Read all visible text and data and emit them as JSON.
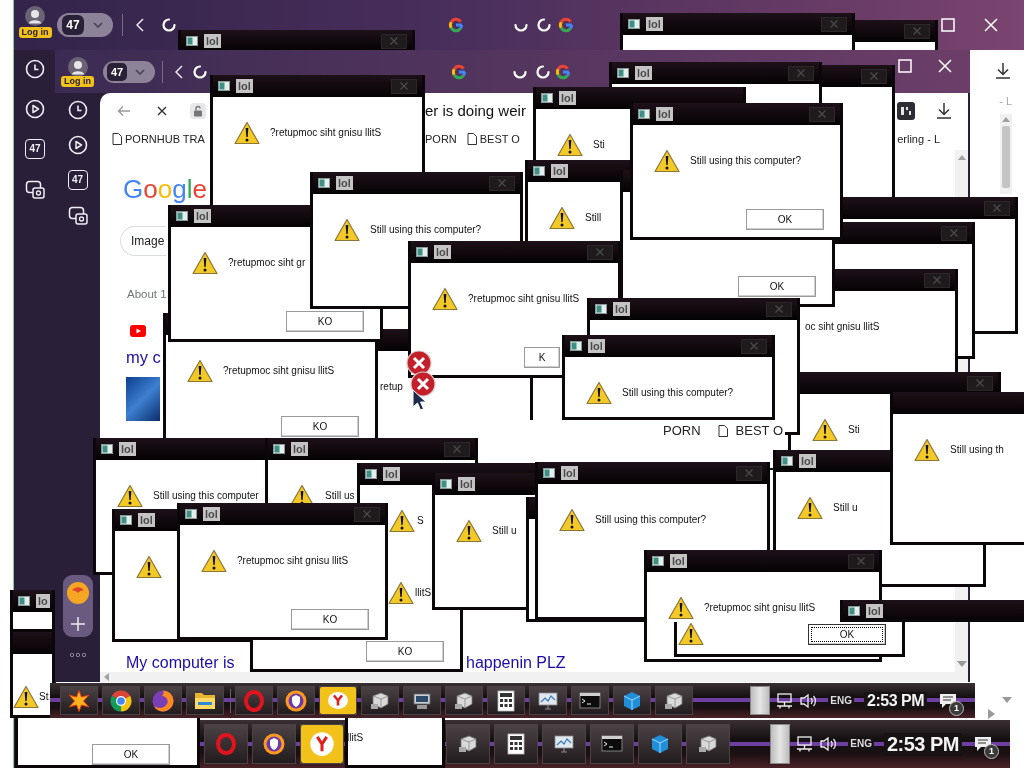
{
  "outer_browser": {
    "login_badge": "Log in",
    "tab_count": "47",
    "sidebar_count": "47",
    "side_text": "- L"
  },
  "dialogs_under_browser": [
    {
      "title": "lol",
      "warning": false
    },
    {
      "warning": false
    },
    {
      "title": "lol",
      "warning": false
    },
    {
      "title": "lo",
      "warning": false
    },
    {
      "warning": true,
      "message": "St"
    }
  ],
  "browser": {
    "login_badge": "Log in",
    "tab_count": "47",
    "sidebar_count": "47",
    "tab_title": "er is doing weir",
    "bookmarks": [
      "PORNHUB TRA",
      "PORN",
      "BEST O",
      "erling - L"
    ],
    "logo": "Google",
    "search_chip": "Image",
    "result_stats": "About 1",
    "result_title": "my c",
    "bottom_links": [
      "My computer is",
      "happenin PLZ"
    ]
  },
  "dialogs": [
    {
      "warning": false
    },
    {
      "title": "lol",
      "warning": false
    },
    {
      "title": "lol",
      "warning": true,
      "message": "Sti"
    },
    {
      "warning": false
    },
    {
      "warning": false
    },
    {
      "warning": false,
      "message": "oc siht gnisu llitS"
    },
    {
      "title": "lol",
      "warning": true,
      "message": "Still"
    },
    {
      "warning": false,
      "button": {
        "label": "OK",
        "focused": false
      }
    },
    {
      "title": "lol",
      "warning": true,
      "message": "Still using this computer?",
      "button": {
        "label": "OK",
        "focused": false
      }
    },
    {
      "warning": true,
      "message": "Sti"
    },
    {
      "title": "lol",
      "warning": true,
      "message": "?retupmoc siht gnisu llitS"
    },
    {
      "warning": false,
      "message": "retup"
    },
    {
      "title": "lol",
      "warning": true,
      "message": "?retupmoc siht gr",
      "button": {
        "label": "KO",
        "focused": false
      }
    },
    {
      "warning": true,
      "message": "?retupmoc siht gnisu llitS",
      "button": {
        "label": "KO",
        "focused": false
      }
    },
    {
      "title": "lol",
      "warning": true,
      "message": "Still using this computer?"
    },
    {
      "title": "lol",
      "warning": true,
      "message": "?retupmoc siht gnisu llitS",
      "button": {
        "label": "K",
        "focused": false
      }
    },
    {
      "title": "lol",
      "warning": false
    },
    {
      "title": "lol",
      "warning": true,
      "message": "Still using this computer?"
    },
    {
      "title": "lol",
      "warning": true,
      "message": "Still using this computer"
    },
    {
      "title": "lol",
      "warning": true,
      "message": "Still us"
    },
    {
      "title": "lol",
      "warning": true
    },
    {
      "title": "lol",
      "warning": true,
      "message": "S"
    },
    {
      "warning": true,
      "message": "llitS",
      "button": {
        "label": "KO",
        "focused": false
      }
    },
    {
      "title": "lol",
      "warning": true,
      "message": "?retupmoc siht gnisu llitS",
      "button": {
        "label": "KO",
        "focused": false
      }
    },
    {
      "title": "lol",
      "warning": true,
      "message": "Still u"
    },
    {
      "warning": false
    },
    {
      "title": "lol",
      "warning": true,
      "message": "Still using this computer?"
    },
    {
      "title": "lol",
      "warning": true,
      "message": "Still u"
    },
    {
      "warning": true,
      "message": "Still using th"
    },
    {
      "title": "lol",
      "warning": true,
      "message": "?retupmoc siht gnisu llitS"
    },
    {
      "title": "lol",
      "warning": false
    },
    {
      "warning": true,
      "button": {
        "label": "OK",
        "focused": true
      }
    }
  ],
  "ghost_bookmarks": [
    "PORN",
    "BEST O"
  ],
  "taskbars": [
    {
      "language": "ENG",
      "clock": "2:53 PM",
      "notification_count": "1"
    },
    {
      "language": "ENG",
      "clock": "2:53 PM",
      "notification_count": "1"
    }
  ],
  "dialogs_over_taskbar": [
    {
      "warning": false,
      "button": {
        "label": "OK",
        "focused": false
      }
    },
    {
      "warning": false,
      "message": "llitS"
    }
  ]
}
